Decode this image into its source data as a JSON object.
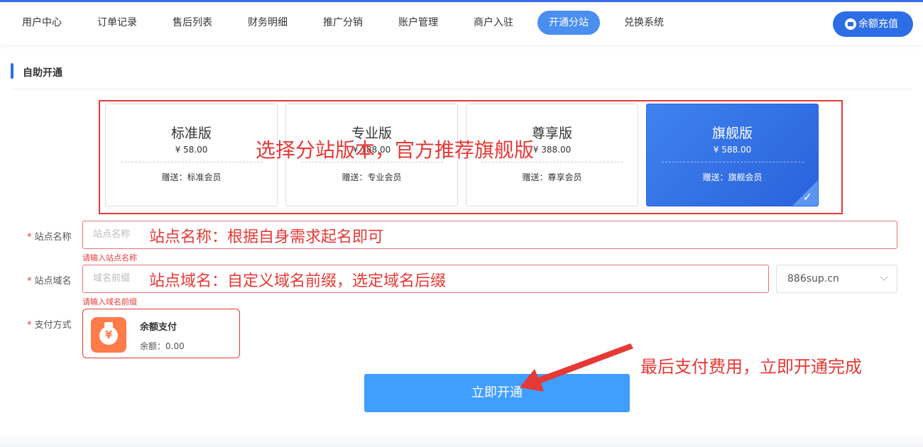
{
  "nav": {
    "items": [
      {
        "label": "用户中心",
        "active": false
      },
      {
        "label": "订单记录",
        "active": false
      },
      {
        "label": "售后列表",
        "active": false
      },
      {
        "label": "财务明细",
        "active": false
      },
      {
        "label": "推广分销",
        "active": false
      },
      {
        "label": "账户管理",
        "active": false
      },
      {
        "label": "商户入驻",
        "active": false
      },
      {
        "label": "开通分站",
        "active": true
      },
      {
        "label": "兑换系统",
        "active": false
      }
    ],
    "recharge_label": "余额充值"
  },
  "section": {
    "title": "自助开通"
  },
  "plans": [
    {
      "name": "标准版",
      "price": "¥ 58.00",
      "gift": "赠送：标准会员",
      "selected": false
    },
    {
      "name": "专业版",
      "price": "¥ 188.00",
      "gift": "赠送：专业会员",
      "selected": false
    },
    {
      "name": "尊享版",
      "price": "¥ 388.00",
      "gift": "赠送：尊享会员",
      "selected": false
    },
    {
      "name": "旗舰版",
      "price": "¥ 588.00",
      "gift": "赠送：旗舰会员",
      "selected": true
    }
  ],
  "form": {
    "site_name": {
      "label": "站点名称",
      "placeholder": "站点名称",
      "error": "请输入站点名称"
    },
    "site_domain": {
      "label": "站点域名",
      "placeholder": "域名前缀",
      "error": "请输入域名前缀",
      "suffix": "886sup.cn"
    },
    "payment": {
      "label": "支付方式",
      "method": "余额支付",
      "balance": "余额：0.00"
    },
    "submit_label": "立即开通"
  },
  "annotations": {
    "plans": "选择分站版本，官方推荐旗舰版",
    "site_name": "站点名称：根据自身需求起名即可",
    "site_domain": "站点域名：自定义域名前缀，选定域名后缀",
    "submit": "最后支付费用，立即开通完成"
  },
  "colors": {
    "primary": "#2d6ee6",
    "button": "#409eff",
    "annotation": "#e53935",
    "pay_icon": "#ff7b4a"
  }
}
